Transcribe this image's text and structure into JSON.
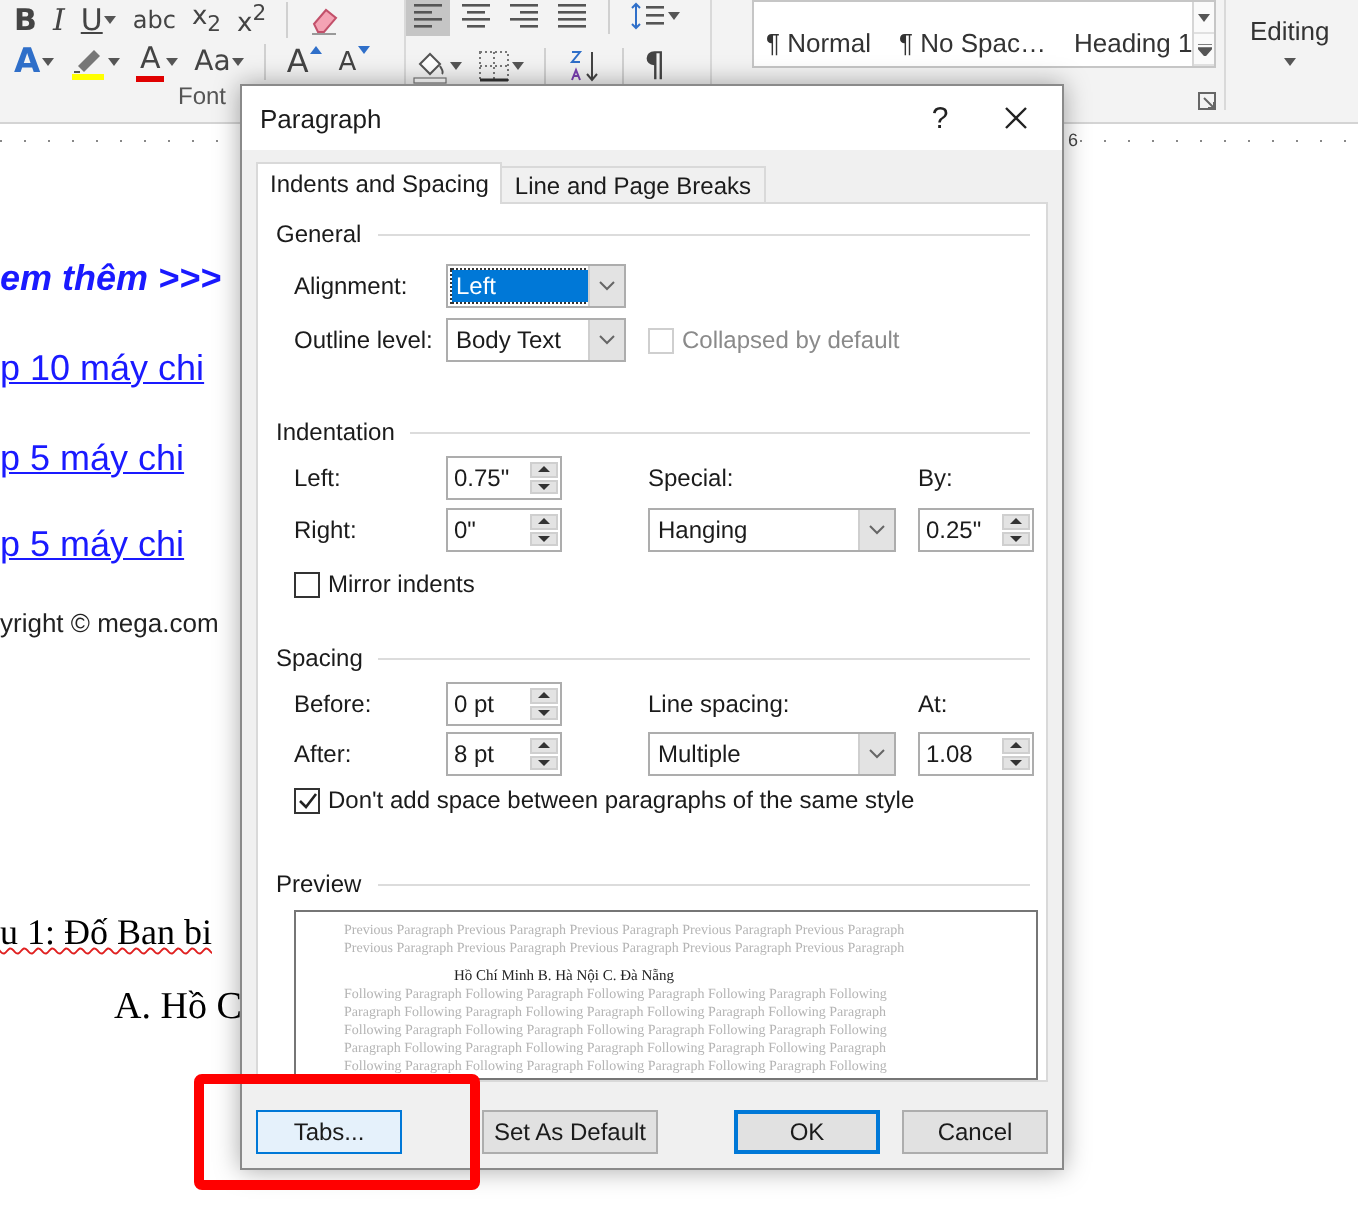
{
  "ribbon": {
    "font_group": {
      "label": "Font",
      "top_row": [
        {
          "kind": "bold",
          "label": "B"
        },
        {
          "kind": "italic",
          "label": "I"
        },
        {
          "kind": "underline",
          "label": "U",
          "dropdown": true
        },
        {
          "kind": "strike",
          "label": "abc"
        },
        {
          "kind": "sub",
          "label": "x$_{2}$"
        },
        {
          "kind": "sup",
          "label": "x$^{2}$"
        },
        {
          "kind": "separator"
        },
        {
          "kind": "eraser"
        }
      ],
      "bottom_row": [
        {
          "kind": "text-effects",
          "label": "A",
          "dropdown": true
        },
        {
          "kind": "highlighter",
          "dropdown": true
        },
        {
          "kind": "font-color",
          "label": "A",
          "dropdown": true
        },
        {
          "kind": "case",
          "label": "Aa",
          "dropdown": true
        },
        {
          "kind": "separator"
        },
        {
          "kind": "grow",
          "label": "A"
        },
        {
          "kind": "shrink",
          "label": "A"
        }
      ]
    },
    "paragraph_group": {
      "top_row": [
        {
          "kind": "align-left",
          "selected": true
        },
        {
          "kind": "align-center",
          "selected": false
        },
        {
          "kind": "align-right",
          "selected": false
        },
        {
          "kind": "justify",
          "selected": false
        },
        {
          "kind": "separator"
        },
        {
          "kind": "line-spacing",
          "dropdown": true
        }
      ],
      "bottom_row": [
        {
          "kind": "shading",
          "dropdown": true
        },
        {
          "kind": "borders",
          "dropdown": true
        },
        {
          "kind": "separator"
        },
        {
          "kind": "sort"
        },
        {
          "kind": "separator"
        },
        {
          "kind": "pilcrow",
          "label": "¶"
        }
      ]
    },
    "styles": [
      {
        "label": "¶ Normal"
      },
      {
        "label": "¶ No Spac…"
      },
      {
        "label": "Heading 1"
      }
    ],
    "editing": {
      "label": "Editing"
    }
  },
  "ruler": {
    "label": "6"
  },
  "document": {
    "lines": [
      {
        "kind": "emphasis",
        "text": "em thêm >>>"
      },
      {
        "kind": "link",
        "text": "p 10 máy chi"
      },
      {
        "kind": "link",
        "text": "p 5 máy chi"
      },
      {
        "kind": "link",
        "text": "p 5 máy chi"
      },
      {
        "kind": "plain",
        "text": "yright © mega.com"
      },
      {
        "kind": "question",
        "text": "u 1: Đố Ban bi"
      },
      {
        "kind": "answer",
        "text": "A. Hồ C"
      }
    ]
  },
  "dialog": {
    "title": "Paragraph",
    "help": "?",
    "tabs": [
      {
        "label": "Indents and Spacing",
        "selected": true
      },
      {
        "label": "Line and Page Breaks",
        "selected": false
      }
    ],
    "general": {
      "title": "General",
      "alignment": {
        "label": "Alignment:",
        "value": "Left",
        "highlighted": true
      },
      "outline_level": {
        "label": "Outline level:",
        "value": "Body Text",
        "highlighted": false
      },
      "collapsed": {
        "label": "Collapsed by default",
        "checked": false,
        "disabled": true
      }
    },
    "indentation": {
      "title": "Indentation",
      "left": {
        "label": "Left:",
        "value": "0.75\""
      },
      "right": {
        "label": "Right:",
        "value": "0\""
      },
      "special": {
        "label": "Special:",
        "value": "Hanging"
      },
      "by": {
        "label": "By:",
        "value": "0.25\""
      },
      "mirror": {
        "label": "Mirror indents",
        "checked": false,
        "disabled": false
      }
    },
    "spacing": {
      "title": "Spacing",
      "before": {
        "label": "Before:",
        "value": "0 pt"
      },
      "after": {
        "label": "After:",
        "value": "8 pt"
      },
      "line_spacing": {
        "label": "Line spacing:",
        "value": "Multiple"
      },
      "at": {
        "label": "At:",
        "value": "1.08"
      },
      "no_space": {
        "label": "Don't add space between paragraphs of the same style",
        "checked": true,
        "disabled": false
      }
    },
    "preview": {
      "title": "Preview",
      "lines": [
        {
          "kind": "previous",
          "text": "Previous Paragraph Previous Paragraph Previous Paragraph Previous Paragraph Previous Paragraph"
        },
        {
          "kind": "previous",
          "text": "Previous Paragraph Previous Paragraph Previous Paragraph Previous Paragraph Previous Paragraph"
        },
        {
          "kind": "current",
          "text": "Hồ Chí Minh  B. Hà Nội  C. Đà Nẵng"
        },
        {
          "kind": "following",
          "text": "Following Paragraph Following Paragraph Following Paragraph Following Paragraph Following"
        },
        {
          "kind": "following",
          "text": "Paragraph Following Paragraph Following Paragraph Following Paragraph Following Paragraph"
        },
        {
          "kind": "following",
          "text": "Following Paragraph Following Paragraph Following Paragraph Following Paragraph Following"
        },
        {
          "kind": "following",
          "text": "Paragraph Following Paragraph Following Paragraph Following Paragraph Following Paragraph"
        },
        {
          "kind": "following",
          "text": "Following Paragraph Following Paragraph Following Paragraph Following Paragraph Following"
        }
      ]
    },
    "buttons": [
      {
        "label": "Tabs...",
        "kind": "hover"
      },
      {
        "label": "Set As Default",
        "kind": "normal"
      },
      {
        "label": "OK",
        "kind": "default"
      },
      {
        "label": "Cancel",
        "kind": "normal"
      }
    ]
  }
}
